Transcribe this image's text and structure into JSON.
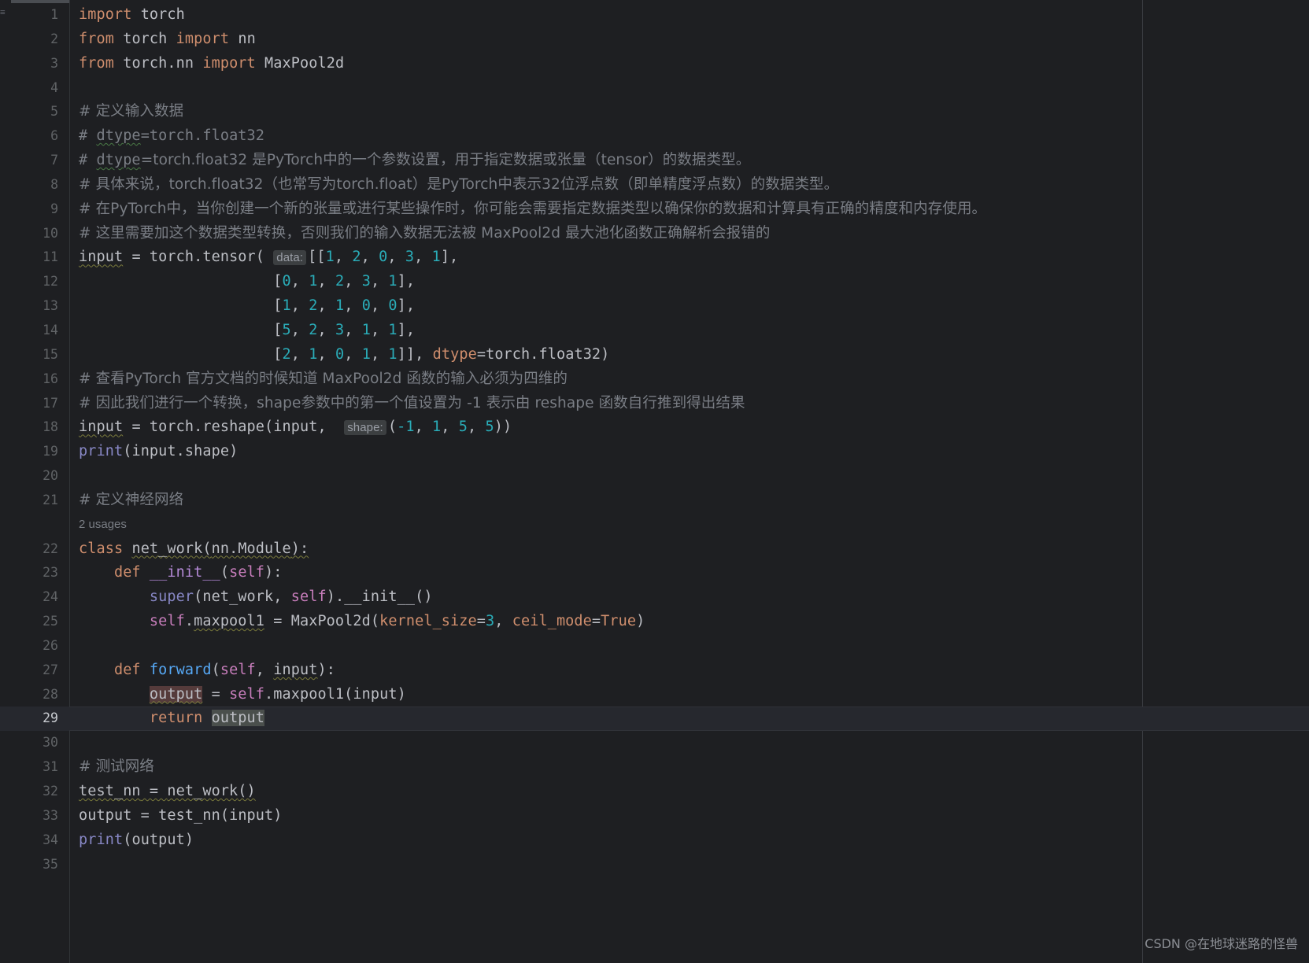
{
  "window": {
    "theme": "dark",
    "background": "#1e1f22",
    "foreground": "#bcbec4",
    "current_line_background": "#26282e",
    "gutter_foreground": "#606366",
    "accent_keyword": "#cf8e6d",
    "accent_number": "#2aacb8",
    "accent_self": "#c77dbb",
    "accent_function": "#56a8f5",
    "accent_builtin": "#8888c6",
    "accent_dunder": "#b389d6",
    "accent_comment": "#7a7e85"
  },
  "gutter": {
    "burger_icon": "hamburger-menu-icon",
    "line_numbers": [
      "1",
      "2",
      "3",
      "4",
      "5",
      "6",
      "7",
      "8",
      "9",
      "10",
      "11",
      "12",
      "13",
      "14",
      "15",
      "16",
      "17",
      "18",
      "19",
      "20",
      "21",
      "22",
      "23",
      "24",
      "25",
      "26",
      "27",
      "28",
      "29",
      "30",
      "31",
      "32",
      "33",
      "34",
      "35"
    ],
    "current_line_number": "29"
  },
  "inlay_hints": {
    "usages_label": "2 usages",
    "data_param": "data:",
    "shape_param": "shape:"
  },
  "code": {
    "lines": [
      {
        "n": "1",
        "text": "import torch"
      },
      {
        "n": "2",
        "text": "from torch import nn"
      },
      {
        "n": "3",
        "text": "from torch.nn import MaxPool2d"
      },
      {
        "n": "4",
        "text": ""
      },
      {
        "n": "5",
        "text": "# 定义输入数据"
      },
      {
        "n": "6",
        "text": "# dtype=torch.float32"
      },
      {
        "n": "7",
        "text": "# dtype=torch.float32 是PyTorch中的一个参数设置，用于指定数据或张量（tensor）的数据类型。"
      },
      {
        "n": "8",
        "text": "# 具体来说，torch.float32（也常写为torch.float）是PyTorch中表示32位浮点数（即单精度浮点数）的数据类型。"
      },
      {
        "n": "9",
        "text": "# 在PyTorch中，当你创建一个新的张量或进行某些操作时，你可能会需要指定数据类型以确保你的数据和计算具有正确的精度和内存使用。"
      },
      {
        "n": "10",
        "text": "# 这里需要加这个数据类型转换，否则我们的输入数据无法被 MaxPool2d 最大池化函数正确解析会报错的"
      },
      {
        "n": "11",
        "text": "input = torch.tensor( data: [[1, 2, 0, 3, 1],"
      },
      {
        "n": "12",
        "text": "                      [0, 1, 2, 3, 1],"
      },
      {
        "n": "13",
        "text": "                      [1, 2, 1, 0, 0],"
      },
      {
        "n": "14",
        "text": "                      [5, 2, 3, 1, 1],"
      },
      {
        "n": "15",
        "text": "                      [2, 1, 0, 1, 1]], dtype=torch.float32)"
      },
      {
        "n": "16",
        "text": "# 查看PyTorch 官方文档的时候知道 MaxPool2d 函数的输入必须为四维的"
      },
      {
        "n": "17",
        "text": "# 因此我们进行一个转换，shape参数中的第一个值设置为 -1 表示由 reshape 函数自行推到得出结果"
      },
      {
        "n": "18",
        "text": "input = torch.reshape(input,  shape: (-1, 1, 5, 5))"
      },
      {
        "n": "19",
        "text": "print(input.shape)"
      },
      {
        "n": "20",
        "text": ""
      },
      {
        "n": "21",
        "text": "# 定义神经网络"
      },
      {
        "n": "22",
        "text": "class net_work(nn.Module):"
      },
      {
        "n": "23",
        "text": "    def __init__(self):"
      },
      {
        "n": "24",
        "text": "        super(net_work, self).__init__()"
      },
      {
        "n": "25",
        "text": "        self.maxpool1 = MaxPool2d(kernel_size=3, ceil_mode=True)"
      },
      {
        "n": "26",
        "text": ""
      },
      {
        "n": "27",
        "text": "    def forward(self, input):"
      },
      {
        "n": "28",
        "text": "        output = self.maxpool1(input)"
      },
      {
        "n": "29",
        "text": "        return output"
      },
      {
        "n": "30",
        "text": ""
      },
      {
        "n": "31",
        "text": "# 测试网络"
      },
      {
        "n": "32",
        "text": "test_nn = net_work()"
      },
      {
        "n": "33",
        "text": "output = test_nn(input)"
      },
      {
        "n": "34",
        "text": "print(output)"
      },
      {
        "n": "35",
        "text": ""
      }
    ],
    "tokens": {
      "import": "import",
      "from": "from",
      "torch": "torch",
      "nn": "nn",
      "torch_nn": "torch.nn",
      "MaxPool2d": "MaxPool2d",
      "class": "class",
      "def": "def",
      "return": "return",
      "self": "self",
      "init": "__init__",
      "super": "super",
      "print": "print",
      "forward": "forward",
      "net_work": "net_work",
      "input": "input",
      "output": "output",
      "test_nn": "test_nn",
      "maxpool1": "maxpool1",
      "nn_Module": "nn.Module",
      "kernel_size": "kernel_size",
      "ceil_mode": "ceil_mode",
      "True": "True",
      "dtype": "dtype",
      "torch_float32": "torch.float32",
      "torch_tensor": "torch.tensor",
      "torch_reshape": "torch.reshape",
      "input_shape": "input.shape"
    }
  },
  "watermark": {
    "text": "CSDN @在地球迷路的怪兽"
  }
}
